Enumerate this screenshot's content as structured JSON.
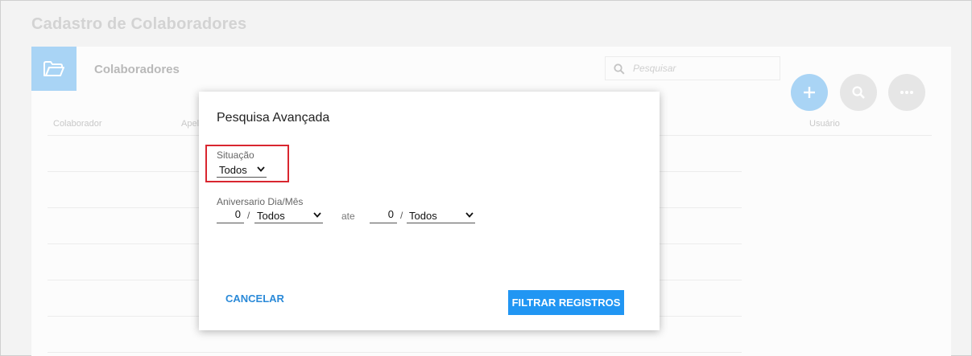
{
  "page": {
    "title": "Cadastro de Colaboradores"
  },
  "card": {
    "title": "Colaboradores",
    "search_placeholder": "Pesquisar",
    "columns": [
      "Colaborador",
      "Apel",
      "Usuário"
    ]
  },
  "fab_icons": [
    "plus-icon",
    "search-icon",
    "more-icon"
  ],
  "modal": {
    "title": "Pesquisa Avançada",
    "situacao": {
      "label": "Situação",
      "value": "Todos"
    },
    "aniversario": {
      "label": "Aniversario Dia/Mês",
      "from_day": "0",
      "from_month": "Todos",
      "separator": "/",
      "between_label": "ate",
      "to_day": "0",
      "to_month": "Todos"
    },
    "cancel_label": "CANCELAR",
    "filter_label": "FILTRAR REGISTROS"
  },
  "colors": {
    "primary": "#2196f3",
    "highlight_border": "#d9262f",
    "fab_light": "#a9d4f5"
  }
}
